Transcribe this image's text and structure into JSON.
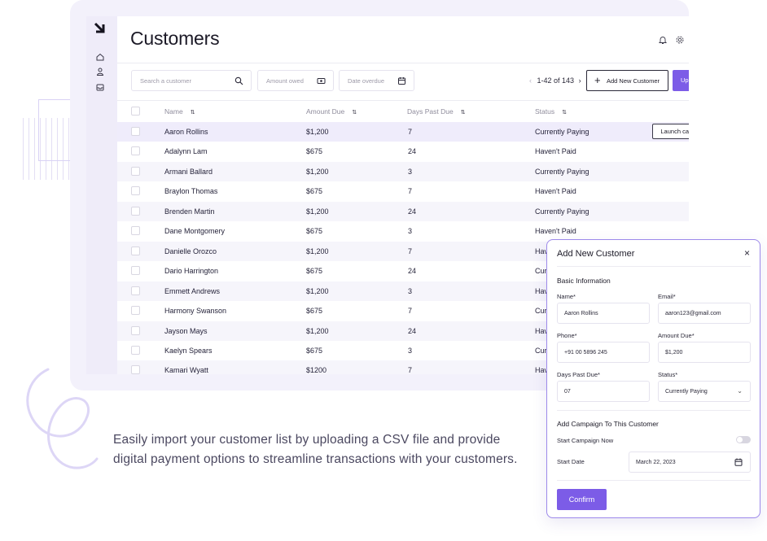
{
  "app": {
    "title": "Customers",
    "search": {
      "placeholder": "Search a customer"
    },
    "filters": [
      {
        "label": "Amount owed"
      },
      {
        "label": "Date overdue"
      }
    ],
    "pagination": {
      "prev": "‹",
      "range": "1-42 of 143",
      "next": "›"
    },
    "add_button": "Add New Customer",
    "upload_button": "Upl",
    "columns": [
      "Name",
      "Amount Due",
      "Days Past Due",
      "Status"
    ],
    "rows": [
      {
        "name": "Aaron Rollins",
        "amount": "$1,200",
        "days": "7",
        "status": "Currently Paying"
      },
      {
        "name": "Adalynn Lam",
        "amount": "$675",
        "days": "24",
        "status": "Haven't Paid"
      },
      {
        "name": "Armani Ballard",
        "amount": "$1,200",
        "days": "3",
        "status": "Currently Paying"
      },
      {
        "name": "Braylon Thomas",
        "amount": "$675",
        "days": "7",
        "status": "Haven't Paid"
      },
      {
        "name": "Brenden Martin",
        "amount": "$1,200",
        "days": "24",
        "status": "Currently Paying"
      },
      {
        "name": "Dane Montgomery",
        "amount": "$675",
        "days": "3",
        "status": "Haven't Paid"
      },
      {
        "name": "Danielle Orozco",
        "amount": "$1,200",
        "days": "7",
        "status": "Hav"
      },
      {
        "name": "Dario Harrington",
        "amount": "$675",
        "days": "24",
        "status": "Cur"
      },
      {
        "name": "Emmett Andrews",
        "amount": "$1,200",
        "days": "3",
        "status": "Hav"
      },
      {
        "name": "Harmony Swanson",
        "amount": "$675",
        "days": "7",
        "status": "Cur"
      },
      {
        "name": "Jayson Mays",
        "amount": "$1,200",
        "days": "24",
        "status": "Hav"
      },
      {
        "name": "Kaelyn Spears",
        "amount": "$675",
        "days": "3",
        "status": "Cur"
      },
      {
        "name": "Kamari Wyatt",
        "amount": "$1200",
        "days": "7",
        "status": "Hav"
      }
    ],
    "launch_button": "Launch campaign"
  },
  "caption": "Easily import your customer list by uploading a CSV file and provide digital payment options to streamline transactions with your customers.",
  "modal": {
    "title": "Add New Customer",
    "close": "×",
    "basic_heading": "Basic Information",
    "name_label": "Name*",
    "name_value": "Aaron Rollins",
    "email_label": "Email*",
    "email_value": "aaron123@gmail.com",
    "phone_label": "Phone*",
    "phone_value": "+91 00 5896 245",
    "amount_label": "Amount Due*",
    "amount_value": "$1,200",
    "days_label": "Days Past Due*",
    "days_value": "07",
    "status_label": "Status*",
    "status_value": "Currently Paying",
    "campaign_heading": "Add Campaign To This Customer",
    "start_now_label": "Start Campaign Now",
    "start_now_on": false,
    "start_date_label": "Start Date",
    "start_date_value": "March 22, 2023",
    "confirm": "Confirm"
  },
  "colors": {
    "accent": "#7c5ce7",
    "sidebar": "#efecf9",
    "backdrop": "#f3f1fb"
  }
}
